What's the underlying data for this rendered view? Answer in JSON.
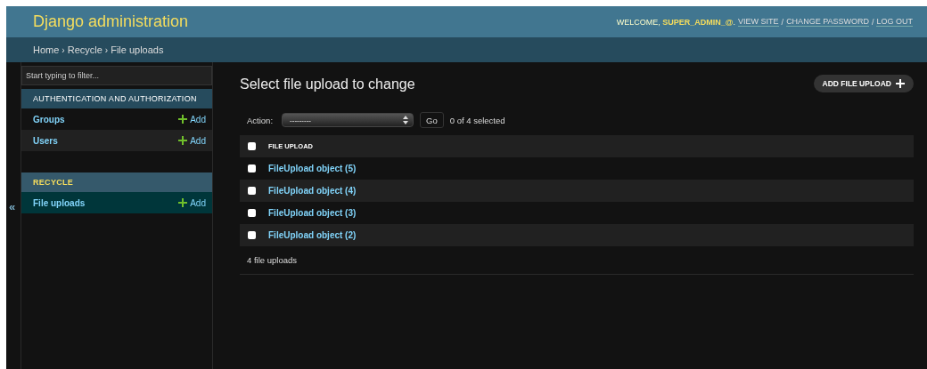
{
  "header": {
    "title": "Django administration",
    "welcome": "WELCOME, **SUPER_ADMIN_@**.",
    "separator": "/",
    "links": [
      "VIEW SITE",
      "CHANGE PASSWORD",
      "LOG OUT"
    ]
  },
  "breadcrumbs": [
    "Home",
    "Recycle",
    "File uploads"
  ],
  "breadcrumb_separator": "›",
  "sidebar": {
    "toggle": "«",
    "filter": {
      "placeholder": "Start typing to filter..."
    },
    "apps": [
      {
        "name": "AUTHENTICATION AND AUTHORIZATION",
        "selected": false,
        "models": [
          {
            "name": "Groups",
            "add": "Add",
            "selected": false
          },
          {
            "name": "Users",
            "add": "Add",
            "selected": false
          }
        ]
      },
      {
        "name": "RECYCLE",
        "selected": true,
        "models": [
          {
            "name": "File uploads",
            "add": "Add",
            "selected": true
          }
        ]
      }
    ]
  },
  "content": {
    "title": "Select file upload to change",
    "add_button": "ADD FILE UPLOAD",
    "action": {
      "label": "Action:",
      "value": "---------",
      "go": "Go",
      "counter": "0 of 4 selected"
    },
    "table": {
      "header": {
        "label": "FILE UPLOAD",
        "checked": false
      },
      "rows": [
        {
          "label": "FileUpload object (5)",
          "checked": false
        },
        {
          "label": "FileUpload object (4)",
          "checked": false
        },
        {
          "label": "FileUpload object (3)",
          "checked": false
        },
        {
          "label": "FileUpload object (2)",
          "checked": false
        }
      ]
    },
    "paginator": "4 file uploads"
  }
}
